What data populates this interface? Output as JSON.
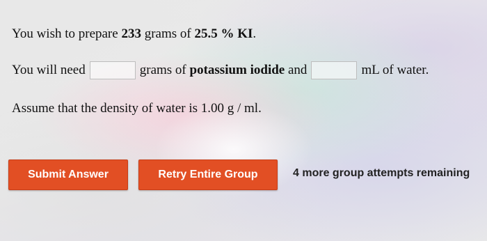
{
  "question": {
    "line1": {
      "prefix": "You wish to prepare ",
      "mass": "233",
      "middle": " grams of ",
      "percent": "25.5 % KI",
      "suffix": "."
    },
    "line2": {
      "prefix": "You will need",
      "after_first_box": "grams of ",
      "compound": "potassium iodide",
      "and": " and",
      "after_second_box": "mL of water."
    },
    "line3": "Assume that the density of water is 1.00 g / ml."
  },
  "inputs": {
    "grams_ki": {
      "value": "",
      "placeholder": ""
    },
    "ml_water": {
      "value": "",
      "placeholder": ""
    }
  },
  "actions": {
    "submit_label": "Submit Answer",
    "retry_label": "Retry Entire Group",
    "attempts_text": "4 more group attempts remaining"
  },
  "colors": {
    "button_bg": "#e24f24",
    "button_text": "#ffffff"
  }
}
